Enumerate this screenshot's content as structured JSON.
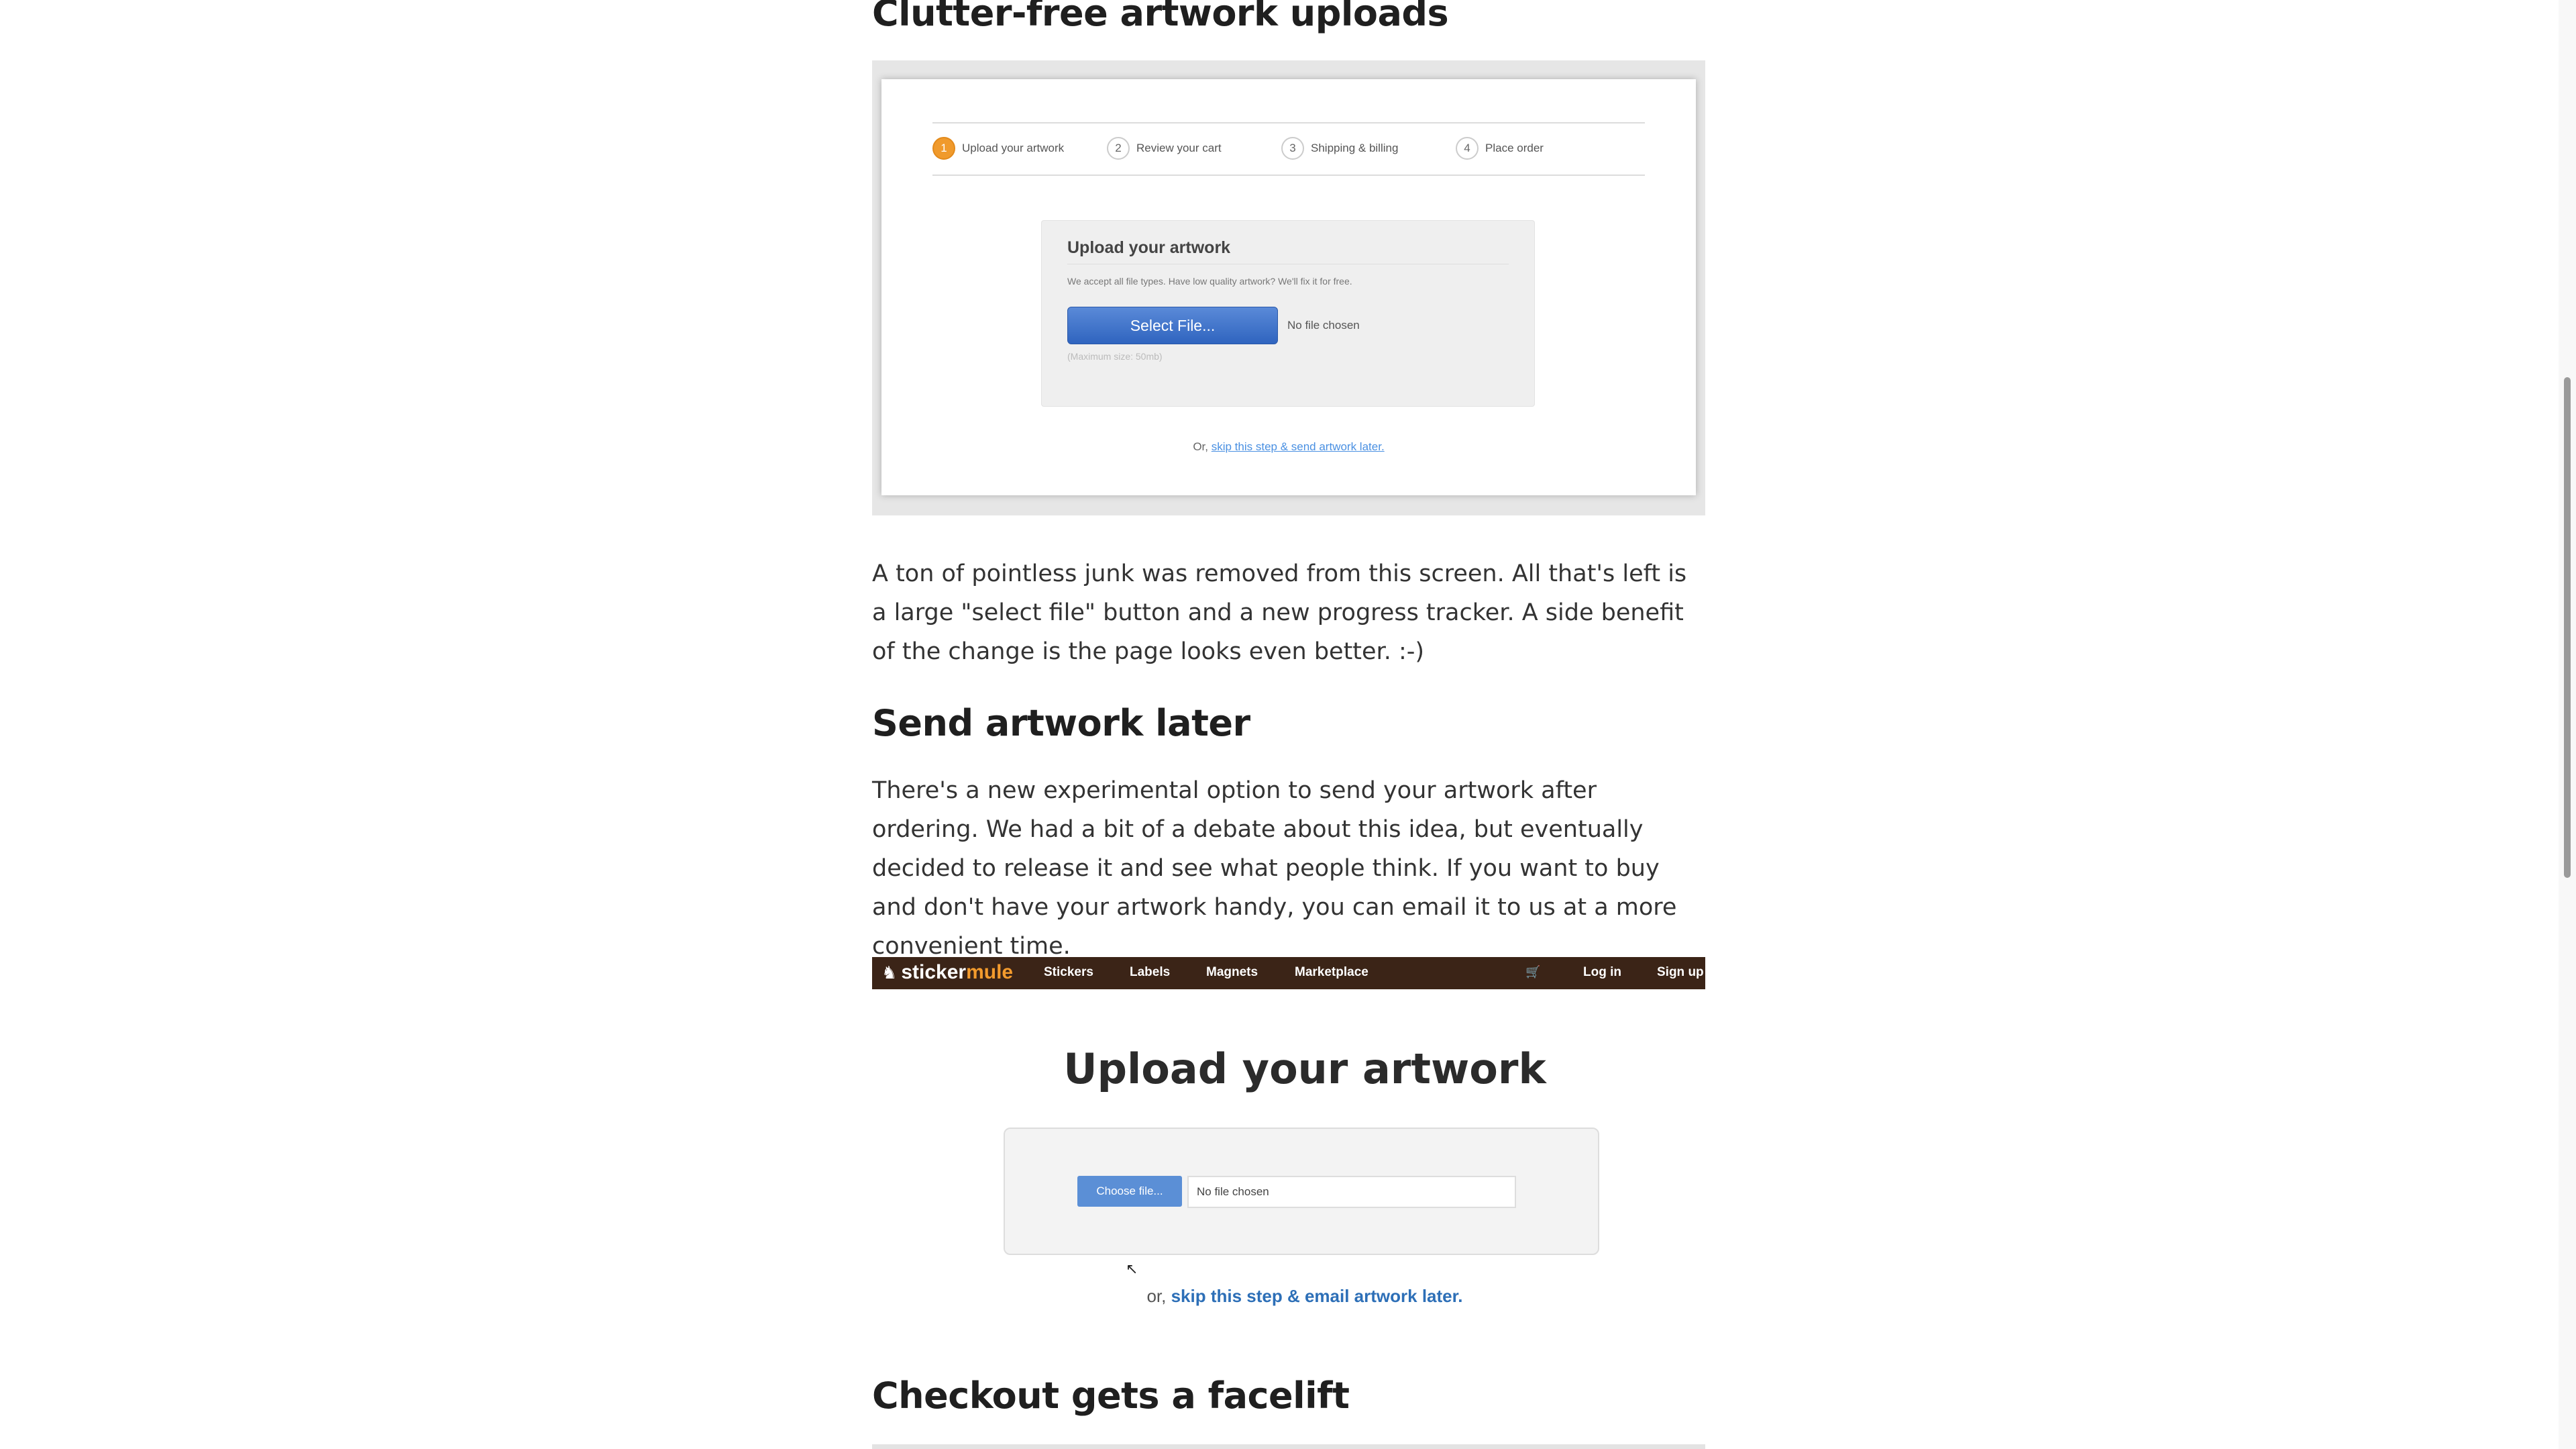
{
  "sections": {
    "clutter_free": {
      "heading": "Clutter-free artwork uploads",
      "paragraph": "A ton of pointless junk was removed from this screen. All that's left is a large \"select file\" button and a new progress tracker. A side benefit of the change is the page looks even better. :-)"
    },
    "send_later": {
      "heading": "Send artwork later",
      "paragraph": "There's a new experimental option to send your artwork after ordering. We had a bit of a debate about this idea, but eventually decided to release it and see what people think. If you want to buy and don't have your artwork handy, you can email it to us at a more convenient time."
    },
    "checkout": {
      "heading": "Checkout gets a facelift"
    }
  },
  "screenshot1": {
    "steps": [
      {
        "num": "1",
        "label": "Upload your artwork"
      },
      {
        "num": "2",
        "label": "Review your cart"
      },
      {
        "num": "3",
        "label": "Shipping & billing"
      },
      {
        "num": "4",
        "label": "Place order"
      }
    ],
    "upload_title": "Upload your artwork",
    "description": "We accept all file types. Have low quality artwork? We'll fix it for free.",
    "select_button": "Select File...",
    "no_file": "No file chosen",
    "max_size": "(Maximum size: 50mb)",
    "skip_prefix": "Or,",
    "skip_link": "skip this step & send artwork later."
  },
  "screenshot2": {
    "logo_main": "sticker",
    "logo_accent": "mule",
    "nav": [
      "Stickers",
      "Labels",
      "Magnets",
      "Marketplace"
    ],
    "cart_icon": "cart-icon",
    "login": "Log in",
    "signup": "Sign up",
    "title": "Upload your artwork",
    "choose_button": "Choose file...",
    "no_file": "No file chosen",
    "skip_prefix": "or,",
    "skip_link": "skip this step & email artwork later."
  }
}
